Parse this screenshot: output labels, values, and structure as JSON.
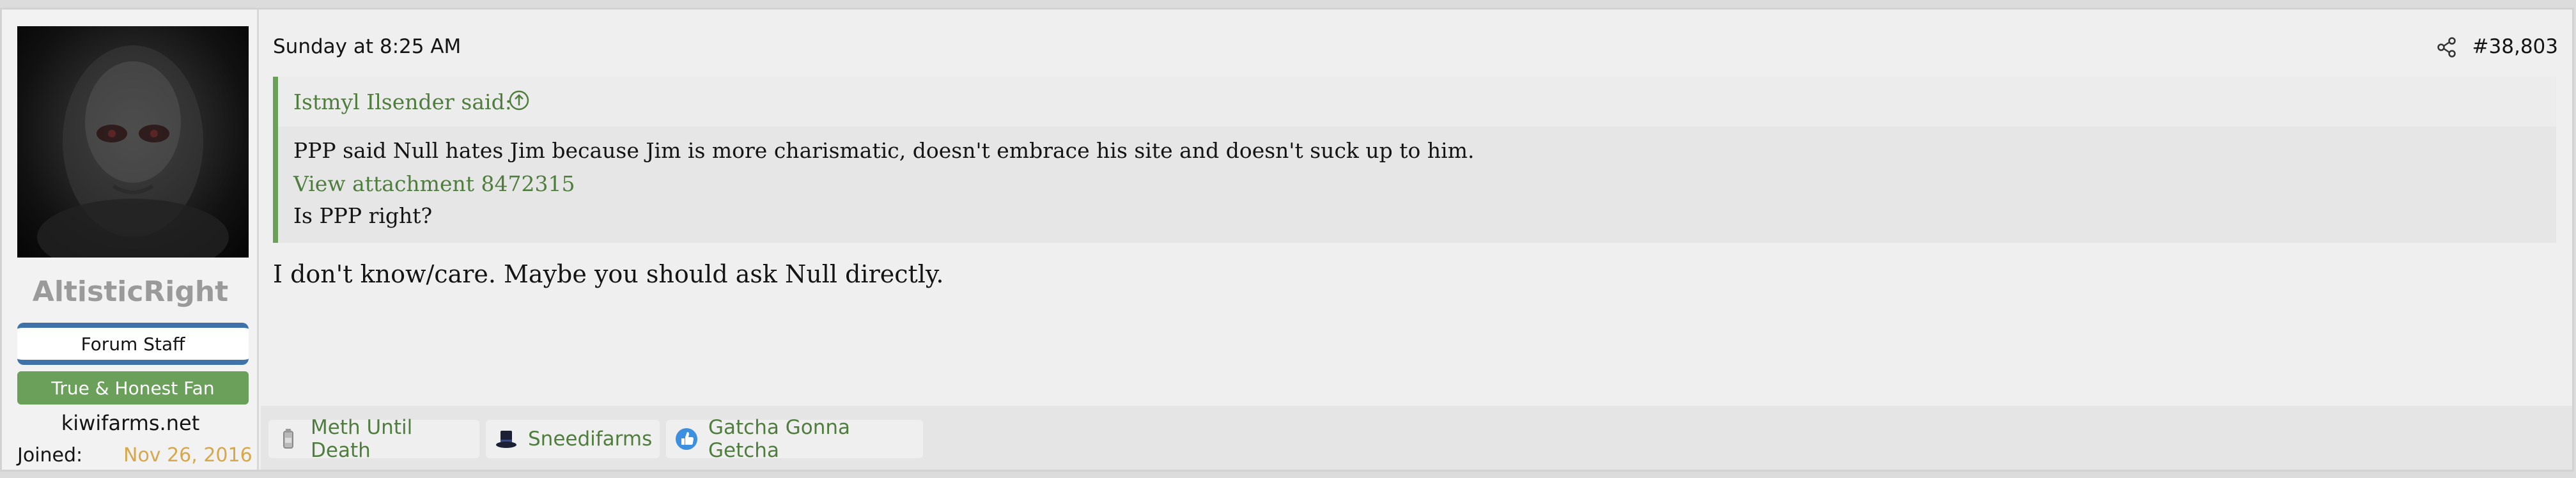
{
  "user": {
    "name": "AltisticRight",
    "badges": [
      "Forum Staff",
      "True & Honest Fan"
    ],
    "site": "kiwifarms.net",
    "joined_label": "Joined:",
    "joined_value": "Nov 26, 2016"
  },
  "post": {
    "timestamp": "Sunday at 8:25 AM",
    "number": "#38,803",
    "quote": {
      "author_label": "Istmyl Ilsender said:",
      "line1": "PPP said Null hates Jim because Jim is more charismatic, doesn't embrace his site and doesn't suck up to him.",
      "attachment_link": "View attachment 8472315",
      "line2": "Is PPP right?"
    },
    "message": "I don't know/care. Maybe you should ask Null directly."
  },
  "reactions": [
    {
      "label": "Meth Until Death",
      "icon": "meth-icon"
    },
    {
      "label": "Sneedifarms",
      "icon": "top-hat-icon"
    },
    {
      "label": "Gatcha Gonna Getcha",
      "icon": "thumbs-up-icon"
    }
  ],
  "colors": {
    "accent_green": "#4f7d3e",
    "badge_green": "#6aa05a",
    "staff_blue": "#3e72a8",
    "joined_gold": "#d7a84b"
  }
}
